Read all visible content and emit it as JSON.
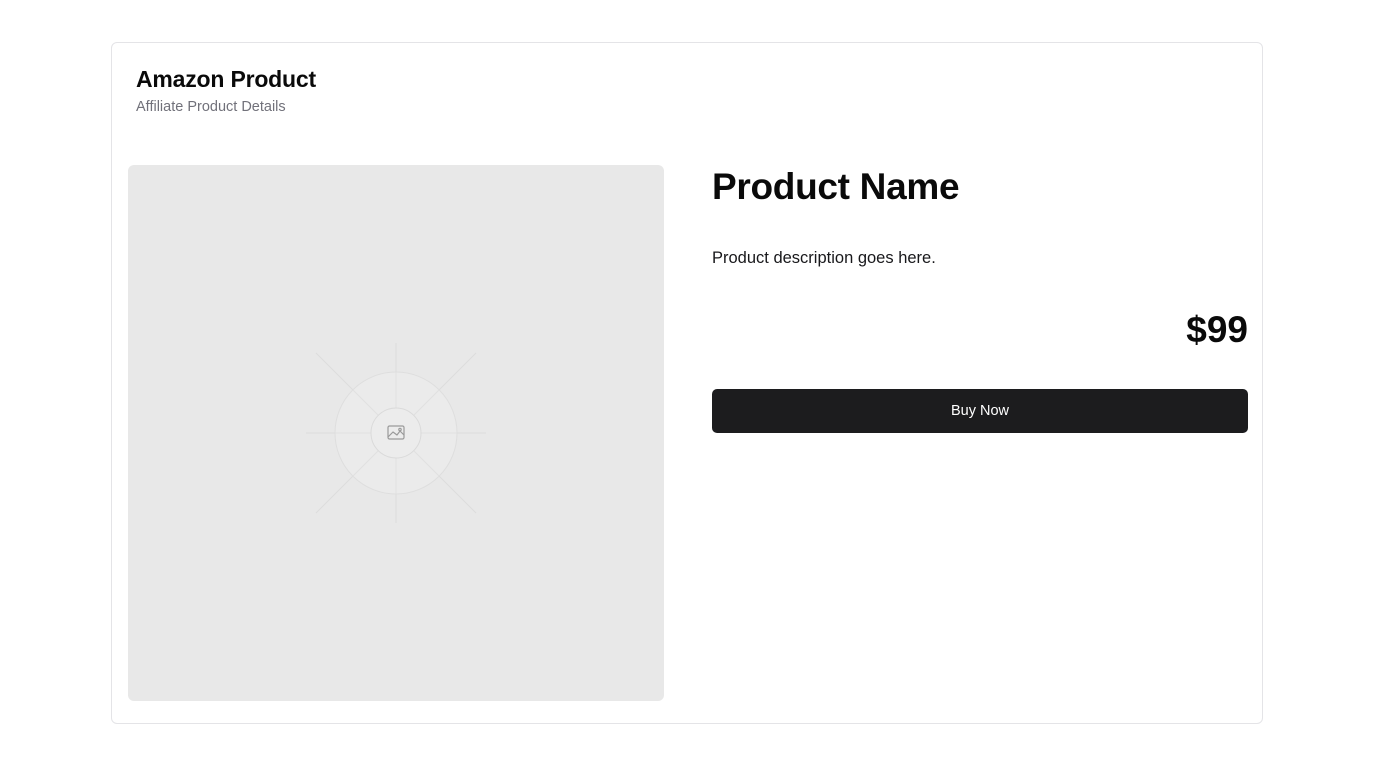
{
  "header": {
    "title": "Amazon Product",
    "subtitle": "Affiliate Product Details"
  },
  "image": {
    "icon": "image-placeholder-icon",
    "background_color": "#e8e8e8"
  },
  "product": {
    "name": "Product Name",
    "description": "Product description goes here.",
    "price": "$99"
  },
  "actions": {
    "buy_label": "Buy Now",
    "button_color": "#1c1c1e"
  }
}
